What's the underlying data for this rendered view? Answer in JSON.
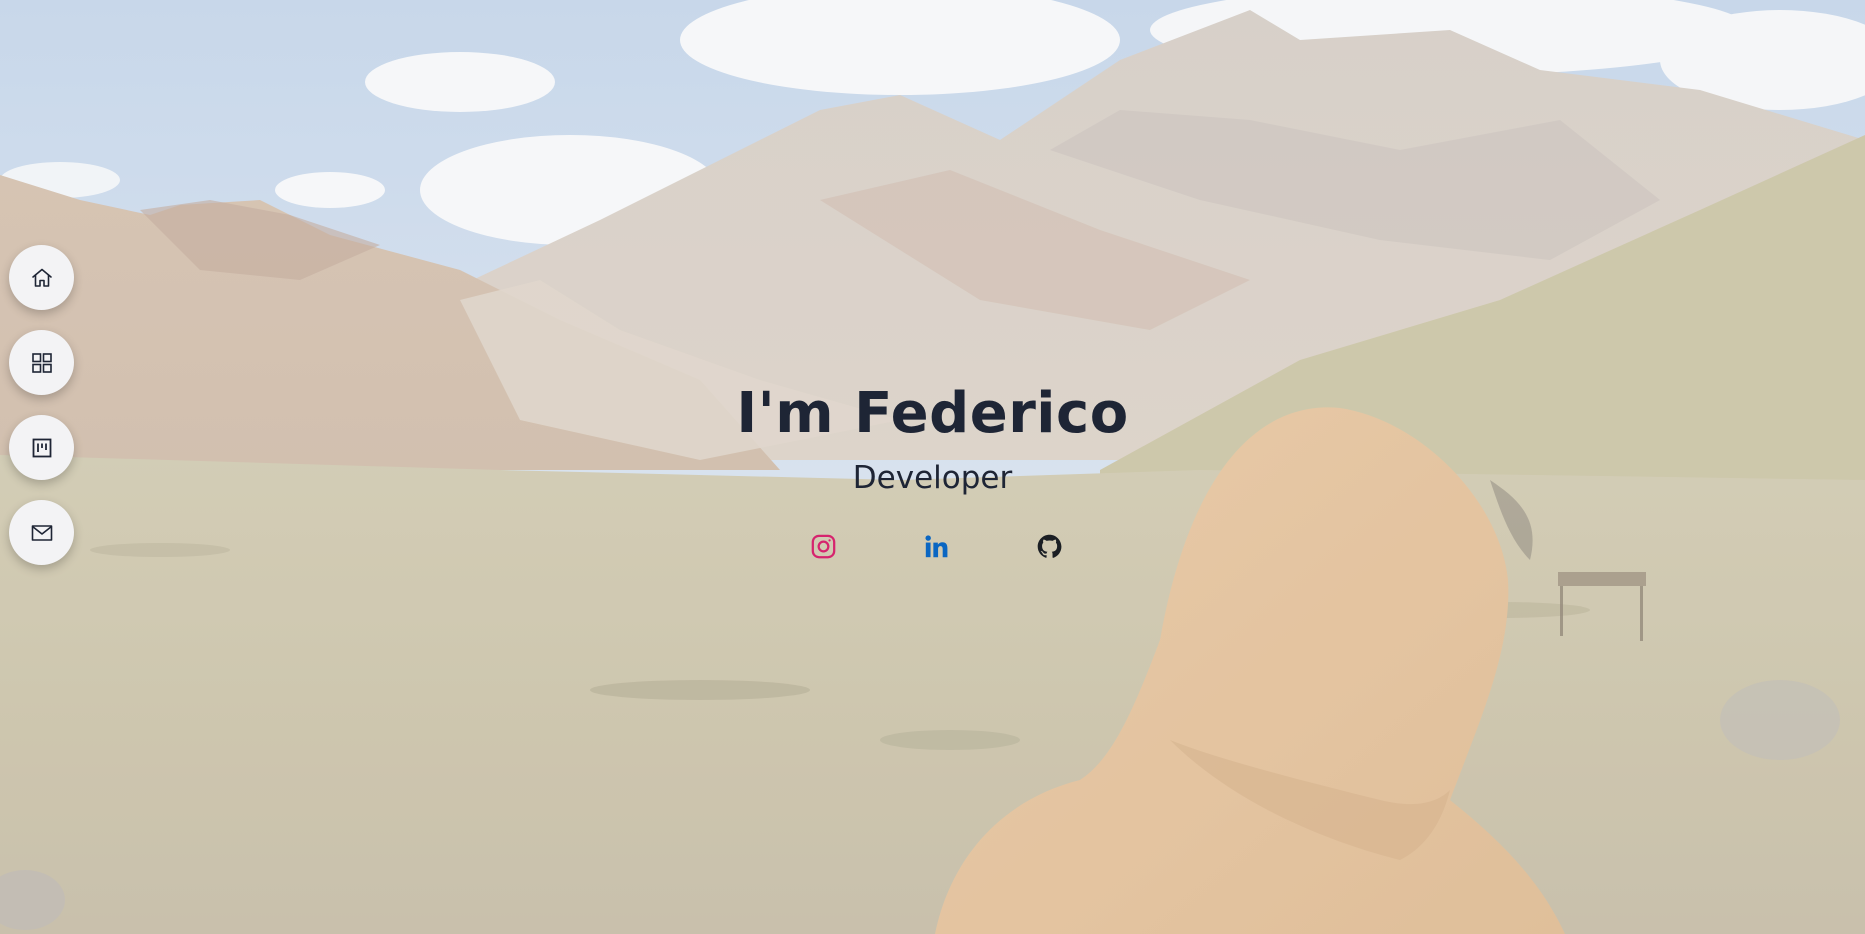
{
  "hero": {
    "title": "I'm Federico",
    "subtitle": "Developer"
  },
  "sidenav": {
    "items": [
      {
        "icon": "home-icon"
      },
      {
        "icon": "grid-icon"
      },
      {
        "icon": "board-icon"
      },
      {
        "icon": "mail-icon"
      }
    ]
  },
  "socials": [
    {
      "icon": "instagram-icon",
      "color": "#d6246e"
    },
    {
      "icon": "linkedin-icon",
      "color": "#0a66c2"
    },
    {
      "icon": "github-icon",
      "color": "#1b1f24"
    }
  ],
  "colors": {
    "text": "#1e2535",
    "nav_bg": "#f3f3f5"
  }
}
